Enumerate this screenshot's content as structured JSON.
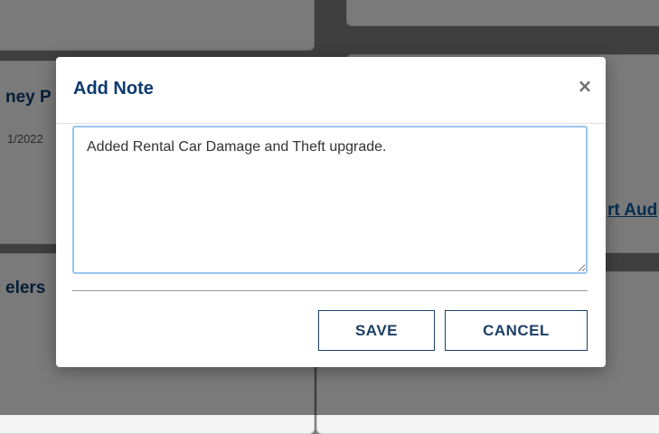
{
  "background": {
    "title_fragment": "ney P",
    "date_fragment": "1/2022",
    "link_fragment": "rt Aud",
    "label_fragment": "elers"
  },
  "modal": {
    "title": "Add Note",
    "close_symbol": "×",
    "note_text": "Added Rental Car Damage and Theft upgrade.",
    "save_label": "SAVE",
    "cancel_label": "CANCEL"
  },
  "colors": {
    "title": "#0c3a6e",
    "button_border": "#1d3f66",
    "textarea_focus_border": "#9cc4ef"
  }
}
